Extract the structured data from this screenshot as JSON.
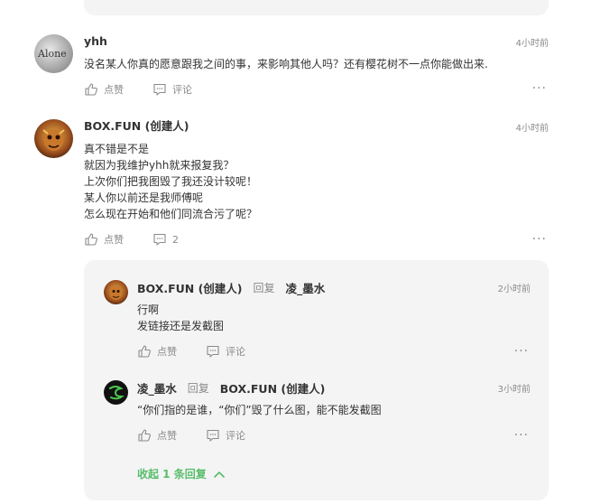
{
  "comments": [
    {
      "author": "yhh",
      "time": "4小时前",
      "avatar_text": "Alone",
      "lines": [
        "没名某人你真的愿意跟我之间的事，来影响其他人吗？还有樱花树不一点你能做出来."
      ],
      "like_label": "点赞",
      "comment_label": "评论",
      "more": "···"
    },
    {
      "author": "BOX.FUN (创建人)",
      "time": "4小时前",
      "lines": [
        "真不错是不是",
        "就因为我维护yhh就来报复我？",
        "上次你们把我图毁了我还没计较呢！",
        "某人你以前还是我师傅呢",
        "怎么现在开始和他们同流合污了呢？"
      ],
      "like_label": "点赞",
      "comment_label": "2",
      "more": "···"
    }
  ],
  "replies": [
    {
      "author": "BOX.FUN (创建人)",
      "reply_word": "回复",
      "target": "凌_墨水",
      "time": "2小时前",
      "lines": [
        "行啊",
        "发链接还是发截图"
      ],
      "like_label": "点赞",
      "comment_label": "评论",
      "more": "···"
    },
    {
      "author": "凌_墨水",
      "reply_word": "回复",
      "target": "BOX.FUN (创建人)",
      "time": "3小时前",
      "lines": [
        "“你们指的是谁，“你们”毁了什么图，能不能发截图"
      ],
      "like_label": "点赞",
      "comment_label": "评论",
      "more": "···"
    }
  ],
  "collapse_label": "收起 1 条回复",
  "colors": {
    "accent": "#57bd6a",
    "meta": "#8a8a8a",
    "panel": "#f4f4f5"
  }
}
